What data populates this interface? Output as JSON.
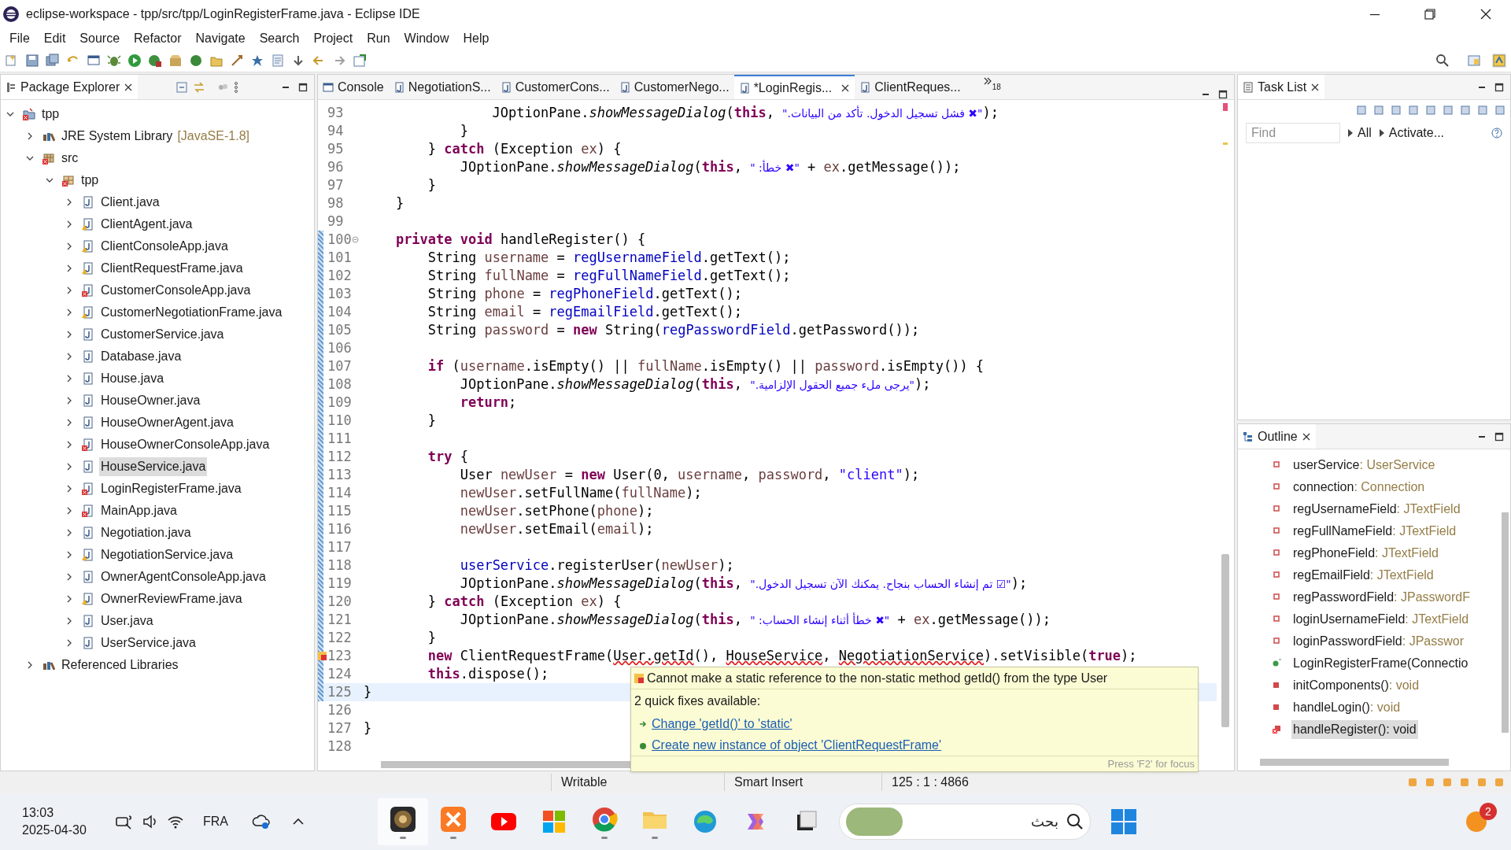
{
  "window": {
    "title": "eclipse-workspace - tpp/src/tpp/LoginRegisterFrame.java - Eclipse IDE"
  },
  "menu": [
    "File",
    "Edit",
    "Source",
    "Refactor",
    "Navigate",
    "Search",
    "Project",
    "Run",
    "Window",
    "Help"
  ],
  "package_explorer": {
    "title": "Package Explorer",
    "tree": [
      {
        "kind": "project",
        "label": "tpp",
        "expanded": true,
        "selected": false,
        "has_error": true,
        "has_warning": false,
        "children": [
          {
            "kind": "library",
            "label": "JRE System Library",
            "detail": "[JavaSE-1.8]",
            "expanded": false,
            "selected": false,
            "has_error": false,
            "has_warning": false
          },
          {
            "kind": "folder",
            "label": "src",
            "expanded": true,
            "selected": false,
            "has_error": true,
            "has_warning": false,
            "children": [
              {
                "kind": "package",
                "label": "tpp",
                "expanded": true,
                "selected": false,
                "has_error": true,
                "has_warning": false,
                "children": [
                  {
                    "kind": "file",
                    "label": "Client.java",
                    "expanded": false,
                    "selected": false,
                    "has_error": false,
                    "has_warning": false
                  },
                  {
                    "kind": "file",
                    "label": "ClientAgent.java",
                    "expanded": false,
                    "selected": false,
                    "has_error": false,
                    "has_warning": true
                  },
                  {
                    "kind": "file",
                    "label": "ClientConsoleApp.java",
                    "expanded": false,
                    "selected": false,
                    "has_error": false,
                    "has_warning": true
                  },
                  {
                    "kind": "file",
                    "label": "ClientRequestFrame.java",
                    "expanded": false,
                    "selected": false,
                    "has_error": false,
                    "has_warning": true
                  },
                  {
                    "kind": "file",
                    "label": "CustomerConsoleApp.java",
                    "expanded": false,
                    "selected": false,
                    "has_error": true,
                    "has_warning": false
                  },
                  {
                    "kind": "file",
                    "label": "CustomerNegotiationFrame.java",
                    "expanded": false,
                    "selected": false,
                    "has_error": false,
                    "has_warning": true
                  },
                  {
                    "kind": "file",
                    "label": "CustomerService.java",
                    "expanded": false,
                    "selected": false,
                    "has_error": false,
                    "has_warning": false
                  },
                  {
                    "kind": "file",
                    "label": "Database.java",
                    "expanded": false,
                    "selected": false,
                    "has_error": false,
                    "has_warning": false
                  },
                  {
                    "kind": "file",
                    "label": "House.java",
                    "expanded": false,
                    "selected": false,
                    "has_error": false,
                    "has_warning": false
                  },
                  {
                    "kind": "file",
                    "label": "HouseOwner.java",
                    "expanded": false,
                    "selected": false,
                    "has_error": false,
                    "has_warning": false
                  },
                  {
                    "kind": "file",
                    "label": "HouseOwnerAgent.java",
                    "expanded": false,
                    "selected": false,
                    "has_error": false,
                    "has_warning": false
                  },
                  {
                    "kind": "file",
                    "label": "HouseOwnerConsoleApp.java",
                    "expanded": false,
                    "selected": false,
                    "has_error": true,
                    "has_warning": false
                  },
                  {
                    "kind": "file",
                    "label": "HouseService.java",
                    "expanded": false,
                    "selected": true,
                    "has_error": false,
                    "has_warning": false
                  },
                  {
                    "kind": "file",
                    "label": "LoginRegisterFrame.java",
                    "expanded": false,
                    "selected": false,
                    "has_error": true,
                    "has_warning": false
                  },
                  {
                    "kind": "file",
                    "label": "MainApp.java",
                    "expanded": false,
                    "selected": false,
                    "has_error": true,
                    "has_warning": false
                  },
                  {
                    "kind": "file",
                    "label": "Negotiation.java",
                    "expanded": false,
                    "selected": false,
                    "has_error": false,
                    "has_warning": false
                  },
                  {
                    "kind": "file",
                    "label": "NegotiationService.java",
                    "expanded": false,
                    "selected": false,
                    "has_error": false,
                    "has_warning": true
                  },
                  {
                    "kind": "file",
                    "label": "OwnerAgentConsoleApp.java",
                    "expanded": false,
                    "selected": false,
                    "has_error": false,
                    "has_warning": false
                  },
                  {
                    "kind": "file",
                    "label": "OwnerReviewFrame.java",
                    "expanded": false,
                    "selected": false,
                    "has_error": false,
                    "has_warning": true
                  },
                  {
                    "kind": "file",
                    "label": "User.java",
                    "expanded": false,
                    "selected": false,
                    "has_error": false,
                    "has_warning": false
                  },
                  {
                    "kind": "file",
                    "label": "UserService.java",
                    "expanded": false,
                    "selected": false,
                    "has_error": false,
                    "has_warning": false
                  }
                ]
              }
            ]
          },
          {
            "kind": "library",
            "label": "Referenced Libraries",
            "expanded": false,
            "selected": false,
            "has_error": false,
            "has_warning": false
          }
        ]
      }
    ]
  },
  "editor_tabs": [
    {
      "label": "Console",
      "selected": false,
      "kind": "console"
    },
    {
      "label": "NegotiationS...",
      "selected": false,
      "kind": "java"
    },
    {
      "label": "CustomerCons...",
      "selected": false,
      "kind": "java"
    },
    {
      "label": "CustomerNego...",
      "selected": false,
      "kind": "java"
    },
    {
      "label": "*LoginRegis...",
      "selected": true,
      "kind": "java"
    },
    {
      "label": "ClientReques...",
      "selected": false,
      "kind": "java"
    }
  ],
  "hidden_tab_count": "18",
  "code_lines": [
    {
      "children": [
        {
          "children": [
            {
              "children": [
                {
                  "children": [
                    {
                      "number": "93",
                      "tokens": [
                        {
                          "kind": "plain",
                          "text": "JOptionPane."
                        },
                        {
                          "kind": "static_method",
                          "text": "showMessageDialog"
                        },
                        {
                          "kind": "plain",
                          "text": "("
                        },
                        {
                          "kind": "keyword",
                          "text": "this"
                        },
                        {
                          "kind": "plain",
                          "text": ", "
                        },
                        {
                          "kind": "arabic_string",
                          "text": "\"✖ فشل تسجيل الدخول. تأكد من البيانات.\""
                        },
                        {
                          "kind": "plain",
                          "text": ");"
                        }
                      ],
                      "changed": false,
                      "current": false,
                      "error": false,
                      "fold": false
                    }
                  ]
                },
                {
                  "number": "94",
                  "tokens": [
                    {
                      "kind": "plain",
                      "text": "}"
                    }
                  ],
                  "changed": false,
                  "current": false,
                  "error": false,
                  "fold": false
                }
              ]
            },
            {
              "number": "95",
              "tokens": [
                {
                  "kind": "plain",
                  "text": "} "
                },
                {
                  "kind": "keyword",
                  "text": "catch"
                },
                {
                  "kind": "plain",
                  "text": " (Exception "
                },
                {
                  "kind": "variable",
                  "text": "ex"
                },
                {
                  "kind": "plain",
                  "text": ") {"
                }
              ],
              "changed": false,
              "current": false,
              "error": false,
              "fold": false,
              "children": [
                {
                  "number": "96",
                  "tokens": [
                    {
                      "kind": "plain",
                      "text": "JOptionPane."
                    },
                    {
                      "kind": "static_method",
                      "text": "showMessageDialog"
                    },
                    {
                      "kind": "plain",
                      "text": "("
                    },
                    {
                      "kind": "keyword",
                      "text": "this"
                    },
                    {
                      "kind": "plain",
                      "text": ", "
                    },
                    {
                      "kind": "arabic_string",
                      "text": "\"✖ خطأ: \""
                    },
                    {
                      "kind": "plain",
                      "text": " + "
                    },
                    {
                      "kind": "variable",
                      "text": "ex"
                    },
                    {
                      "kind": "plain",
                      "text": ".getMessage());"
                    }
                  ],
                  "changed": false,
                  "current": false,
                  "error": false,
                  "fold": false
                }
              ]
            },
            {
              "number": "97",
              "tokens": [
                {
                  "kind": "plain",
                  "text": "}"
                }
              ],
              "changed": false,
              "current": false,
              "error": false,
              "fold": false
            }
          ]
        },
        {
          "number": "98",
          "tokens": [
            {
              "kind": "plain",
              "text": "}"
            }
          ],
          "changed": false,
          "current": false,
          "error": false,
          "fold": false
        },
        {
          "number": "99",
          "changed": false,
          "current": false,
          "error": false,
          "fold": false
        },
        {
          "number": "100",
          "tokens": [
            {
              "kind": "keyword",
              "text": "private void"
            },
            {
              "kind": "plain",
              "text": " handleRegister() {"
            }
          ],
          "changed": true,
          "current": false,
          "error": false,
          "fold": true,
          "children": [
            {
              "number": "101",
              "tokens": [
                {
                  "kind": "plain",
                  "text": "String "
                },
                {
                  "kind": "variable",
                  "text": "username"
                },
                {
                  "kind": "plain",
                  "text": " = "
                },
                {
                  "kind": "field",
                  "text": "regUsernameField"
                },
                {
                  "kind": "plain",
                  "text": ".getText();"
                }
              ],
              "changed": true,
              "current": false,
              "error": false,
              "fold": false
            },
            {
              "number": "102",
              "tokens": [
                {
                  "kind": "plain",
                  "text": "String "
                },
                {
                  "kind": "variable",
                  "text": "fullName"
                },
                {
                  "kind": "plain",
                  "text": " = "
                },
                {
                  "kind": "field",
                  "text": "regFullNameField"
                },
                {
                  "kind": "plain",
                  "text": ".getText();"
                }
              ],
              "changed": true,
              "current": false,
              "error": false,
              "fold": false
            },
            {
              "number": "103",
              "tokens": [
                {
                  "kind": "plain",
                  "text": "String "
                },
                {
                  "kind": "variable",
                  "text": "phone"
                },
                {
                  "kind": "plain",
                  "text": " = "
                },
                {
                  "kind": "field",
                  "text": "regPhoneField"
                },
                {
                  "kind": "plain",
                  "text": ".getText();"
                }
              ],
              "changed": true,
              "current": false,
              "error": false,
              "fold": false
            },
            {
              "number": "104",
              "tokens": [
                {
                  "kind": "plain",
                  "text": "String "
                },
                {
                  "kind": "variable",
                  "text": "email"
                },
                {
                  "kind": "plain",
                  "text": " = "
                },
                {
                  "kind": "field",
                  "text": "regEmailField"
                },
                {
                  "kind": "plain",
                  "text": ".getText();"
                }
              ],
              "changed": true,
              "current": false,
              "error": false,
              "fold": false
            },
            {
              "number": "105",
              "tokens": [
                {
                  "kind": "plain",
                  "text": "String "
                },
                {
                  "kind": "variable",
                  "text": "password"
                },
                {
                  "kind": "plain",
                  "text": " = "
                },
                {
                  "kind": "keyword",
                  "text": "new"
                },
                {
                  "kind": "plain",
                  "text": " String("
                },
                {
                  "kind": "field",
                  "text": "regPasswordField"
                },
                {
                  "kind": "plain",
                  "text": ".getPassword());"
                }
              ],
              "changed": true,
              "current": false,
              "error": false,
              "fold": false
            },
            {
              "number": "106",
              "changed": true,
              "current": false,
              "error": false,
              "fold": false
            },
            {
              "number": "107",
              "tokens": [
                {
                  "kind": "keyword",
                  "text": "if"
                },
                {
                  "kind": "plain",
                  "text": " ("
                },
                {
                  "kind": "variable",
                  "text": "username"
                },
                {
                  "kind": "plain",
                  "text": ".isEmpty() || "
                },
                {
                  "kind": "variable",
                  "text": "fullName"
                },
                {
                  "kind": "plain",
                  "text": ".isEmpty() || "
                },
                {
                  "kind": "variable",
                  "text": "password"
                },
                {
                  "kind": "plain",
                  "text": ".isEmpty()) {"
                }
              ],
              "changed": true,
              "current": false,
              "error": false,
              "fold": false,
              "children": [
                {
                  "number": "108",
                  "tokens": [
                    {
                      "kind": "plain",
                      "text": "JOptionPane."
                    },
                    {
                      "kind": "static_method",
                      "text": "showMessageDialog"
                    },
                    {
                      "kind": "plain",
                      "text": "("
                    },
                    {
                      "kind": "keyword",
                      "text": "this"
                    },
                    {
                      "kind": "plain",
                      "text": ", "
                    },
                    {
                      "kind": "arabic_string",
                      "text": "\"يرجى ملء جميع الحقول الإلزامية.\""
                    },
                    {
                      "kind": "plain",
                      "text": ");"
                    }
                  ],
                  "changed": true,
                  "current": false,
                  "error": false,
                  "fold": false
                },
                {
                  "number": "109",
                  "tokens": [
                    {
                      "kind": "keyword",
                      "text": "return"
                    },
                    {
                      "kind": "plain",
                      "text": ";"
                    }
                  ],
                  "changed": true,
                  "current": false,
                  "error": false,
                  "fold": false
                }
              ]
            },
            {
              "number": "110",
              "tokens": [
                {
                  "kind": "plain",
                  "text": "}"
                }
              ],
              "changed": true,
              "current": false,
              "error": false,
              "fold": false
            },
            {
              "number": "111",
              "changed": true,
              "current": false,
              "error": false,
              "fold": false
            },
            {
              "number": "112",
              "tokens": [
                {
                  "kind": "keyword",
                  "text": "try"
                },
                {
                  "kind": "plain",
                  "text": " {"
                }
              ],
              "changed": true,
              "current": false,
              "error": false,
              "fold": false,
              "children": [
                {
                  "number": "113",
                  "tokens": [
                    {
                      "kind": "plain",
                      "text": "User "
                    },
                    {
                      "kind": "variable",
                      "text": "newUser"
                    },
                    {
                      "kind": "plain",
                      "text": " = "
                    },
                    {
                      "kind": "keyword",
                      "text": "new"
                    },
                    {
                      "kind": "plain",
                      "text": " User(0, "
                    },
                    {
                      "kind": "variable",
                      "text": "username"
                    },
                    {
                      "kind": "plain",
                      "text": ", "
                    },
                    {
                      "kind": "variable",
                      "text": "password"
                    },
                    {
                      "kind": "plain",
                      "text": ", "
                    },
                    {
                      "kind": "string",
                      "text": "\"client\""
                    },
                    {
                      "kind": "plain",
                      "text": ");"
                    }
                  ],
                  "changed": true,
                  "current": false,
                  "error": false,
                  "fold": false
                },
                {
                  "number": "114",
                  "tokens": [
                    {
                      "kind": "variable",
                      "text": "newUser"
                    },
                    {
                      "kind": "plain",
                      "text": ".setFullName("
                    },
                    {
                      "kind": "variable",
                      "text": "fullName"
                    },
                    {
                      "kind": "plain",
                      "text": ");"
                    }
                  ],
                  "changed": true,
                  "current": false,
                  "error": false,
                  "fold": false
                },
                {
                  "number": "115",
                  "tokens": [
                    {
                      "kind": "variable",
                      "text": "newUser"
                    },
                    {
                      "kind": "plain",
                      "text": ".setPhone("
                    },
                    {
                      "kind": "variable",
                      "text": "phone"
                    },
                    {
                      "kind": "plain",
                      "text": ");"
                    }
                  ],
                  "changed": true,
                  "current": false,
                  "error": false,
                  "fold": false
                },
                {
                  "number": "116",
                  "tokens": [
                    {
                      "kind": "variable",
                      "text": "newUser"
                    },
                    {
                      "kind": "plain",
                      "text": ".setEmail("
                    },
                    {
                      "kind": "variable",
                      "text": "email"
                    },
                    {
                      "kind": "plain",
                      "text": ");"
                    }
                  ],
                  "changed": true,
                  "current": false,
                  "error": false,
                  "fold": false
                },
                {
                  "number": "117",
                  "changed": true,
                  "current": false,
                  "error": false,
                  "fold": false
                },
                {
                  "number": "118",
                  "tokens": [
                    {
                      "kind": "field",
                      "text": "userService"
                    },
                    {
                      "kind": "plain",
                      "text": ".registerUser("
                    },
                    {
                      "kind": "variable",
                      "text": "newUser"
                    },
                    {
                      "kind": "plain",
                      "text": ");"
                    }
                  ],
                  "changed": true,
                  "current": false,
                  "error": false,
                  "fold": false
                },
                {
                  "number": "119",
                  "tokens": [
                    {
                      "kind": "plain",
                      "text": "JOptionPane."
                    },
                    {
                      "kind": "static_method",
                      "text": "showMessageDialog"
                    },
                    {
                      "kind": "plain",
                      "text": "("
                    },
                    {
                      "kind": "keyword",
                      "text": "this"
                    },
                    {
                      "kind": "plain",
                      "text": ", "
                    },
                    {
                      "kind": "arabic_string",
                      "text": "\"☑ تم إنشاء الحساب بنجاح. يمكنك الآن تسجيل الدخول.\""
                    },
                    {
                      "kind": "plain",
                      "text": ");"
                    }
                  ],
                  "changed": true,
                  "current": false,
                  "error": false,
                  "fold": false
                }
              ]
            },
            {
              "number": "120",
              "tokens": [
                {
                  "kind": "plain",
                  "text": "} "
                },
                {
                  "kind": "keyword",
                  "text": "catch"
                },
                {
                  "kind": "plain",
                  "text": " (Exception "
                },
                {
                  "kind": "variable",
                  "text": "ex"
                },
                {
                  "kind": "plain",
                  "text": ") {"
                }
              ],
              "changed": true,
              "current": false,
              "error": false,
              "fold": false,
              "children": [
                {
                  "number": "121",
                  "tokens": [
                    {
                      "kind": "plain",
                      "text": "JOptionPane."
                    },
                    {
                      "kind": "static_method",
                      "text": "showMessageDialog"
                    },
                    {
                      "kind": "plain",
                      "text": "("
                    },
                    {
                      "kind": "keyword",
                      "text": "this"
                    },
                    {
                      "kind": "plain",
                      "text": ", "
                    },
                    {
                      "kind": "arabic_string",
                      "text": "\"✖ خطأ أثناء إنشاء الحساب: \""
                    },
                    {
                      "kind": "plain",
                      "text": " + "
                    },
                    {
                      "kind": "variable",
                      "text": "ex"
                    },
                    {
                      "kind": "plain",
                      "text": ".getMessage());"
                    }
                  ],
                  "changed": true,
                  "current": false,
                  "error": false,
                  "fold": false
                }
              ]
            },
            {
              "number": "122",
              "tokens": [
                {
                  "kind": "plain",
                  "text": "}"
                }
              ],
              "changed": true,
              "current": false,
              "error": false,
              "fold": false
            },
            {
              "number": "123",
              "tokens": [
                {
                  "kind": "keyword",
                  "text": "new"
                },
                {
                  "kind": "plain",
                  "text": " ClientRequestFrame("
                },
                {
                  "kind": "error",
                  "text": "User.getId"
                },
                {
                  "kind": "plain",
                  "text": "(), "
                },
                {
                  "kind": "error",
                  "text": "HouseService"
                },
                {
                  "kind": "plain",
                  "text": ", "
                },
                {
                  "kind": "error",
                  "text": "NegotiationService"
                },
                {
                  "kind": "plain",
                  "text": ").setVisible("
                },
                {
                  "kind": "keyword",
                  "text": "true"
                },
                {
                  "kind": "plain",
                  "text": ");"
                }
              ],
              "changed": true,
              "current": false,
              "error": true,
              "fold": false
            },
            {
              "number": "124",
              "tokens": [
                {
                  "kind": "keyword",
                  "text": "this"
                },
                {
                  "kind": "plain",
                  "text": ".dispose();"
                }
              ],
              "changed": true,
              "current": false,
              "error": false,
              "fold": false
            }
          ]
        }
      ]
    },
    {
      "number": "125",
      "tokens": [
        {
          "kind": "plain",
          "text": "}"
        }
      ],
      "changed": true,
      "current": true,
      "error": false,
      "fold": false
    },
    {
      "number": "126",
      "changed": false,
      "current": false,
      "error": false,
      "fold": false
    },
    {
      "number": "127",
      "tokens": [
        {
          "kind": "plain",
          "text": "}"
        }
      ],
      "changed": false,
      "current": false,
      "error": false,
      "fold": false
    },
    {
      "number": "128",
      "changed": false,
      "current": false,
      "error": false,
      "fold": false
    }
  ],
  "hover": {
    "message": "Cannot make a static reference to the non-static method getId() from the type User",
    "subtitle": "2 quick fixes available:",
    "fixes": [
      {
        "label": "Change 'getId()' to 'static'",
        "kind": "change"
      },
      {
        "label": "Create new instance of object 'ClientRequestFrame'",
        "kind": "create"
      }
    ],
    "hint": "Press 'F2' for focus"
  },
  "task_list": {
    "title": "Task List",
    "find_placeholder": "Find",
    "filters": [
      "All",
      "Activate..."
    ]
  },
  "outline": {
    "title": "Outline",
    "items": [
      {
        "kind": "field",
        "name": "userService",
        "type": " : UserService",
        "selected": false
      },
      {
        "kind": "field",
        "name": "connection",
        "type": " : Connection",
        "selected": false
      },
      {
        "kind": "field",
        "name": "regUsernameField",
        "type": " : JTextField",
        "selected": false
      },
      {
        "kind": "field",
        "name": "regFullNameField",
        "type": " : JTextField",
        "selected": false
      },
      {
        "kind": "field",
        "name": "regPhoneField",
        "type": " : JTextField",
        "selected": false
      },
      {
        "kind": "field",
        "name": "regEmailField",
        "type": " : JTextField",
        "selected": false
      },
      {
        "kind": "field",
        "name": "regPasswordField",
        "type": " : JPasswordF",
        "selected": false
      },
      {
        "kind": "field",
        "name": "loginUsernameField",
        "type": " : JTextField",
        "selected": false
      },
      {
        "kind": "field",
        "name": "loginPasswordField",
        "type": " : JPasswor",
        "selected": false
      },
      {
        "kind": "constructor",
        "name": "LoginRegisterFrame(Connectio",
        "selected": false
      },
      {
        "kind": "method",
        "name": "initComponents()",
        "type": " : void",
        "selected": false
      },
      {
        "kind": "method",
        "name": "handleLogin()",
        "type": " : void",
        "selected": false
      },
      {
        "kind": "error_method",
        "name": "handleRegister()",
        "type": " : void",
        "selected": true
      }
    ]
  },
  "status_bar": [
    "Writable",
    "Smart Insert",
    "125 : 1 : 4866"
  ],
  "taskbar": {
    "time": "13:03",
    "date": "2025-04-30",
    "language": "FRA",
    "search_placeholder": "بحث",
    "notification_count": "2"
  }
}
